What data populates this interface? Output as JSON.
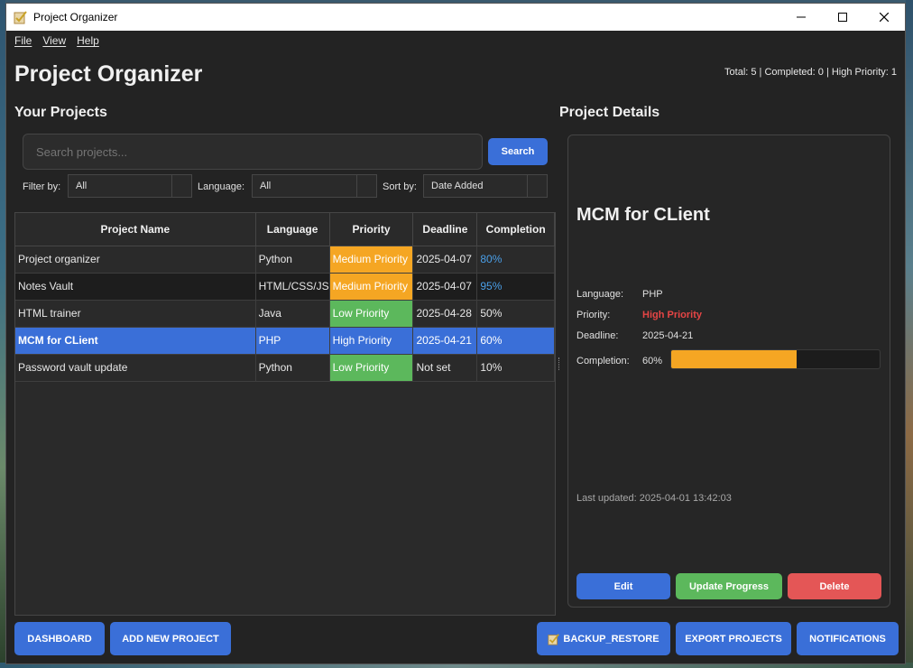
{
  "window": {
    "title": "Project Organizer"
  },
  "menu": [
    "File",
    "View",
    "Help"
  ],
  "header": {
    "title": "Project Organizer",
    "stats": "Total: 5 | Completed: 0 | High Priority: 1"
  },
  "projects_panel": {
    "title": "Your Projects",
    "search_placeholder": "Search projects...",
    "search_button": "Search",
    "filter_label": "Filter by:",
    "filter_value": "All",
    "language_label": "Language:",
    "language_value": "All",
    "sort_label": "Sort by:",
    "sort_value": "Date Added"
  },
  "table": {
    "columns": [
      "Project Name",
      "Language",
      "Priority",
      "Deadline",
      "Completion"
    ],
    "rows": [
      {
        "name": "Project organizer",
        "language": "Python",
        "priority": "Medium Priority",
        "deadline": "2025-04-07",
        "completion": "80%"
      },
      {
        "name": "Notes Vault",
        "language": "HTML/CSS/JS",
        "priority": "Medium Priority",
        "deadline": "2025-04-07",
        "completion": "95%"
      },
      {
        "name": "HTML trainer",
        "language": "Java",
        "priority": "Low Priority",
        "deadline": "2025-04-28",
        "completion": "50%"
      },
      {
        "name": "MCM for CLient",
        "language": "PHP",
        "priority": "High Priority",
        "deadline": "2025-04-21",
        "completion": "60%"
      },
      {
        "name": "Password vault update",
        "language": "Python",
        "priority": "Low Priority",
        "deadline": "Not set",
        "completion": "10%"
      }
    ]
  },
  "details": {
    "title": "Project Details",
    "name": "MCM for CLient",
    "language_label": "Language:",
    "language": "PHP",
    "priority_label": "Priority:",
    "priority": "High Priority",
    "deadline_label": "Deadline:",
    "deadline": "2025-04-21",
    "completion_label": "Completion:",
    "completion": "60%",
    "completion_fraction": 0.6,
    "last_updated": "Last updated: 2025-04-01 13:42:03",
    "edit_button": "Edit",
    "update_button": "Update Progress",
    "delete_button": "Delete"
  },
  "footer": {
    "dashboard": "DASHBOARD",
    "add_new": "ADD NEW PROJECT",
    "backup": "BACKUP_RESTORE",
    "export": "EXPORT PROJECTS",
    "notifications": "NOTIFICATIONS"
  },
  "colors": {
    "accent_blue": "#3a6fd8",
    "medium_priority": "#f5a623",
    "low_priority": "#5cb85c",
    "high_priority_text": "#e64545",
    "delete_red": "#e45656",
    "completion_link": "#4a9fe8"
  }
}
